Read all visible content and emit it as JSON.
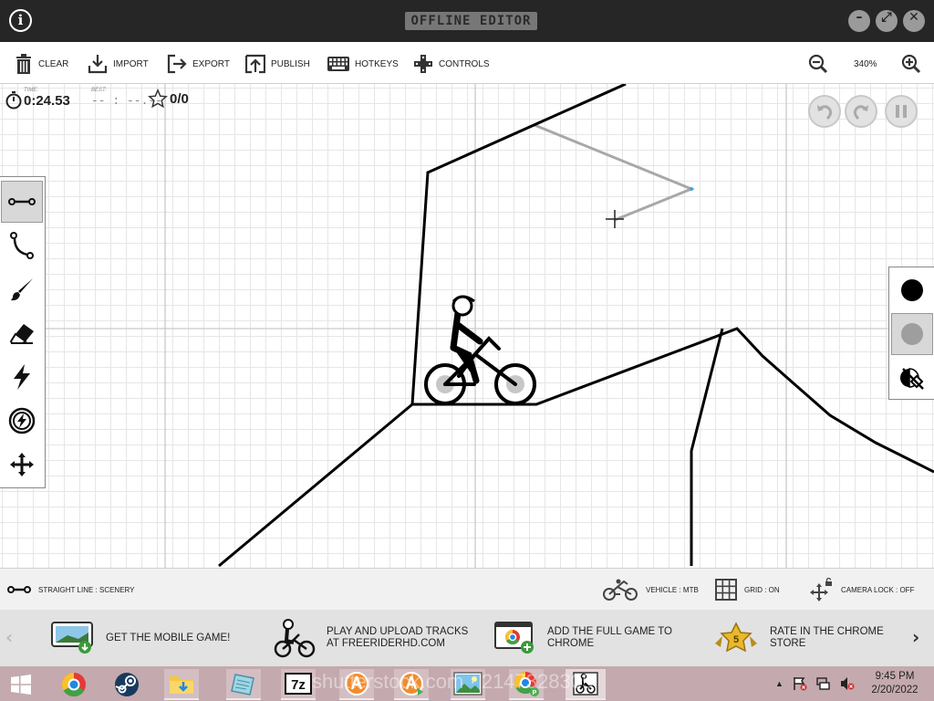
{
  "window": {
    "title": "OFFLINE EDITOR",
    "info_label": "i"
  },
  "toolbar": {
    "clear": "CLEAR",
    "import": "IMPORT",
    "export": "EXPORT",
    "publish": "PUBLISH",
    "hotkeys": "HOTKEYS",
    "controls": "CONTROLS",
    "zoom": "340%"
  },
  "hud": {
    "time_label": "TIME:",
    "time_value": "0:24.53",
    "best_label": "BEST:",
    "best_value": "-- : --.--",
    "stars_value": "0/0"
  },
  "tools": [
    {
      "name": "straight-line",
      "icon": "straight-line-icon",
      "active": true
    },
    {
      "name": "curve",
      "icon": "curve-icon",
      "active": false
    },
    {
      "name": "brush",
      "icon": "brush-icon",
      "active": false
    },
    {
      "name": "eraser",
      "icon": "eraser-icon",
      "active": false
    },
    {
      "name": "powerup",
      "icon": "lightning-icon",
      "active": false
    },
    {
      "name": "powerup-circle",
      "icon": "lightning-circle-icon",
      "active": false
    },
    {
      "name": "move",
      "icon": "move-arrows-icon",
      "active": false
    }
  ],
  "colors": {
    "physics": "#000000",
    "scenery": "#9e9e9e",
    "active": "scenery"
  },
  "status": {
    "mode": "STRAIGHT LINE : SCENERY",
    "vehicle": "VEHICLE : MTB",
    "grid": "GRID : ON",
    "camera": "CAMERA LOCK : OFF"
  },
  "promos": [
    {
      "text": "GET THE MOBILE GAME!"
    },
    {
      "line1": "PLAY AND UPLOAD TRACKS",
      "line2": "AT FREERIDERHD.COM"
    },
    {
      "line1": "ADD THE FULL GAME TO",
      "line2": "CHROME"
    },
    {
      "line1": "RATE IN THE CHROME",
      "line2": "STORE",
      "badge": "5"
    }
  ],
  "taskbar": {
    "time": "9:45 PM",
    "date": "2/20/2022",
    "apps": [
      "start-icon",
      "chrome-icon",
      "steam-icon",
      "file-explorer-icon",
      "notes-app-icon",
      "7zip-icon",
      "app-orange-icon",
      "app-orange-2-icon",
      "photos-icon",
      "chrome-profile-icon",
      "freerider-icon"
    ]
  },
  "watermark": "shutterstock.com · 2147328305"
}
